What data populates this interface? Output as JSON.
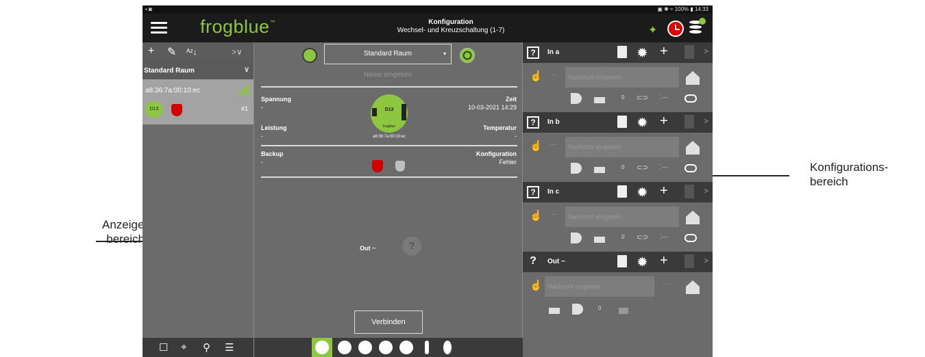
{
  "annotations": {
    "left_label_line1": "Anzeigen-",
    "left_label_line2": "bereich",
    "right_label_line1": "Konfigurations-",
    "right_label_line2": "bereich"
  },
  "statusbar": {
    "left": "▪ ◙",
    "right": "▣ ✱ ≈ 100% ▮ 14:33"
  },
  "appbar": {
    "logo": "frogblue",
    "logo_tm": "™",
    "title": "Konfiguration",
    "subtitle": "Wechsel- und Kreuzschaltung (1-7)"
  },
  "left_panel": {
    "toolbar": {
      "add": "+",
      "edit": "✎",
      "sort": "ᴬᶻ↓",
      "more": ">∨"
    },
    "room": "Standard Raum",
    "room_caret": "∨",
    "device": {
      "mac": "a8:36:7a:00:10:ec",
      "chip": "D13",
      "number": "#1"
    },
    "bottom": {
      "square": "☐",
      "locate": "⌖",
      "search": "⚲",
      "list": "☰"
    }
  },
  "center_panel": {
    "room_select": "Standard Raum",
    "caret": "▾",
    "name_placeholder": "Name eingeben",
    "spannung_label": "Spannung",
    "spannung_value": "-",
    "zeit_label": "Zeit",
    "zeit_value": "10-03-2021 14:29",
    "leistung_label": "Leistung",
    "leistung_value": "-",
    "temperatur_label": "Temperatur",
    "temperatur_value": "-",
    "backup_label": "Backup",
    "backup_value": "-",
    "konfiguration_label": "Konfiguration",
    "konfiguration_value": "Fehler",
    "chip_label": "D13",
    "chip_brand": "frogblue",
    "chip_mac": "a8:36:7a:00:10:ec",
    "out_label": "Out ~",
    "bulb_mark": "?",
    "connect_button": "Verbinden"
  },
  "right_panel": {
    "sections": [
      {
        "label": "In a",
        "message_placeholder": "Nachricht eingeben",
        "zero": "0"
      },
      {
        "label": "In b",
        "message_placeholder": "Nachricht eingeben",
        "zero": "0"
      },
      {
        "label": "In c",
        "message_placeholder": "Nachricht eingeben",
        "zero": "0"
      },
      {
        "label": "Out ~",
        "message_placeholder": "Nachricht eingeben",
        "zero": "0"
      }
    ],
    "icons": {
      "question": "?",
      "gear": "✹",
      "plus": "+",
      "chevron": ">",
      "hand": "☝",
      "dash": "—",
      "link": "⊂⊃",
      "dots": "⁚—"
    }
  },
  "colors": {
    "accent_green": "#8dc63f",
    "alert_red": "#e10000",
    "panel_grey": "#6b6b6b",
    "header_dark": "#1b1b1b"
  }
}
